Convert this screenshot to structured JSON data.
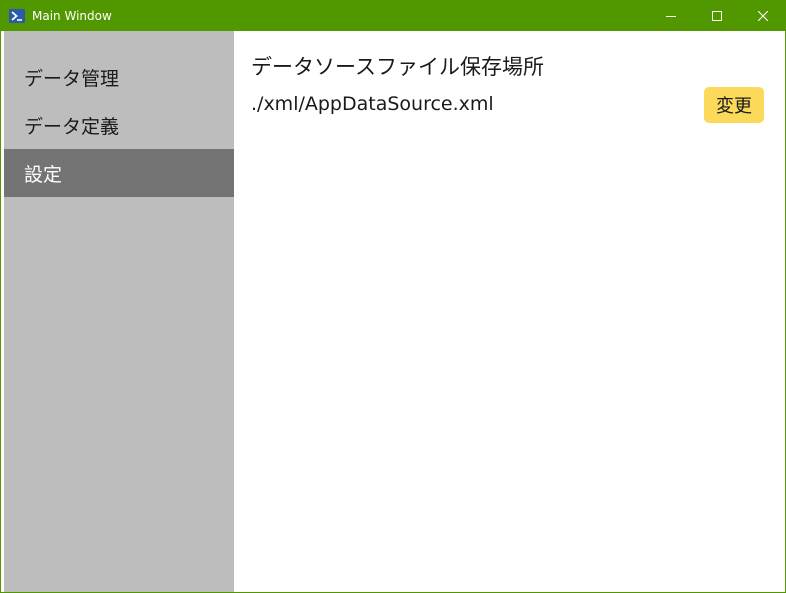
{
  "window": {
    "title": "Main Window",
    "accent_color": "#519800"
  },
  "titlebar": {
    "app_icon": "powershell-icon",
    "buttons": [
      "minimize-icon",
      "maximize-icon",
      "close-icon"
    ]
  },
  "sidebar": {
    "items": [
      {
        "label": "データ管理",
        "selected": false
      },
      {
        "label": "データ定義",
        "selected": false
      },
      {
        "label": "設定",
        "selected": true
      }
    ],
    "background": "#bdbdbd",
    "selected_background": "#747474"
  },
  "main": {
    "heading": "データソースファイル保存場所",
    "path_value": "./xml/AppDataSource.xml",
    "change_button_label": "変更",
    "change_button_color": "#fbd95a"
  }
}
